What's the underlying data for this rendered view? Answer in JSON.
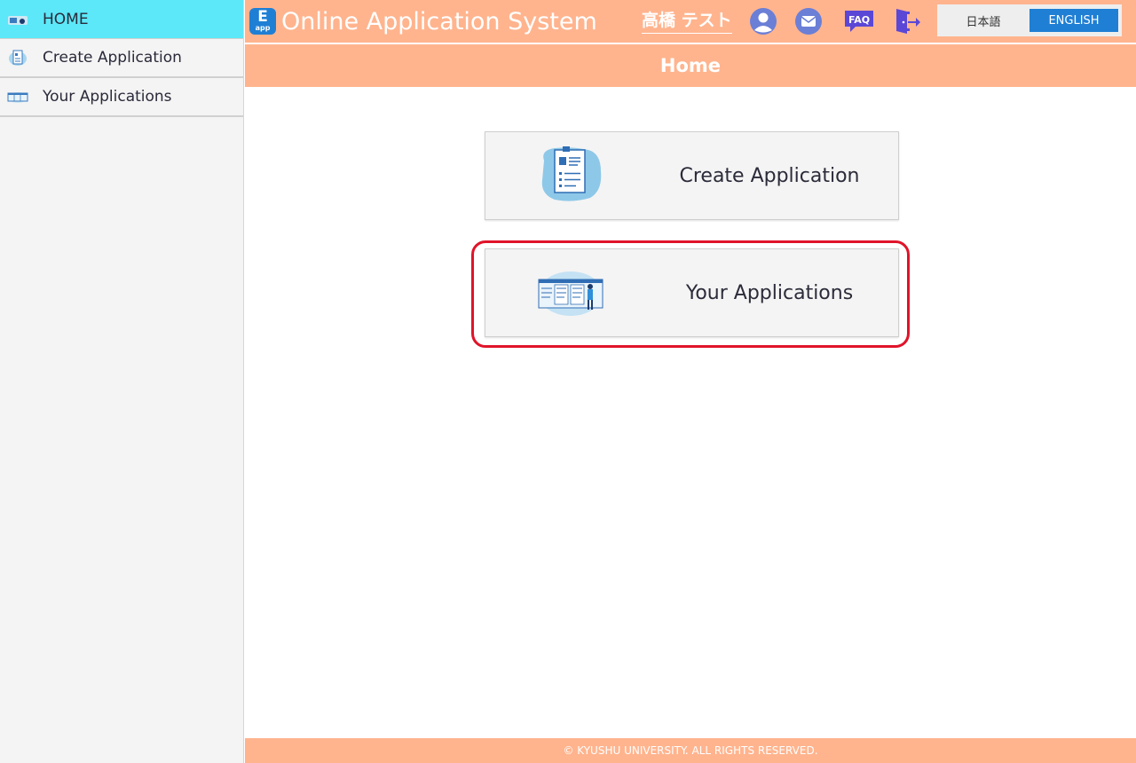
{
  "sidebar": {
    "items": [
      {
        "label": "HOME",
        "icon": "home-icon",
        "active": true
      },
      {
        "label": "Create Application",
        "icon": "document-icon",
        "active": false
      },
      {
        "label": "Your Applications",
        "icon": "list-window-icon",
        "active": false
      }
    ]
  },
  "header": {
    "logo_big": "E",
    "logo_small": "app",
    "title": "Online Application System",
    "user_name": "高橋 テスト",
    "faq_label": "FAQ",
    "languages": {
      "ja": "日本語",
      "en": "ENGLISH"
    },
    "selected_language": "ENGLISH"
  },
  "page": {
    "title": "Home"
  },
  "cards": [
    {
      "label": "Create Application",
      "icon": "create-application-illustration"
    },
    {
      "label": "Your Applications",
      "icon": "your-applications-illustration"
    }
  ],
  "footer": {
    "text": "© KYUSHU UNIVERSITY. ALL RIGHTS RESERVED."
  },
  "colors": {
    "header_bg": "#ffb48e",
    "sidebar_active_bg": "#5ce8f8",
    "accent_blue": "#1f7fd4",
    "highlight_red": "#e0142a"
  }
}
